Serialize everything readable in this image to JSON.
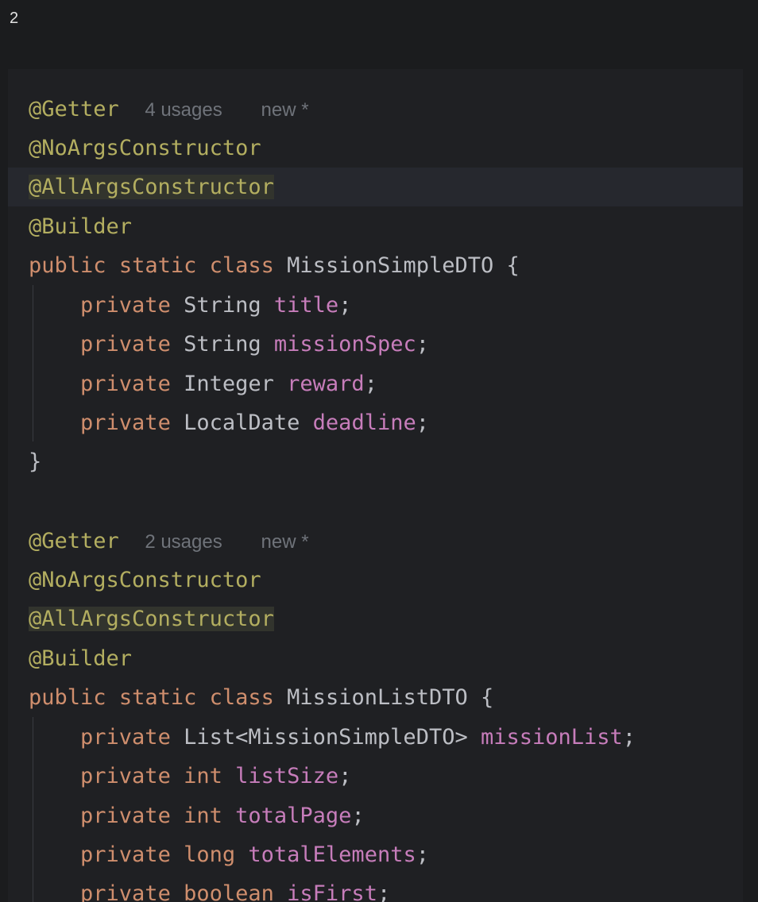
{
  "page_label": "2",
  "code": {
    "block1": {
      "annotation_getter": "@Getter",
      "usages_hint": "4 usages",
      "new_hint": "new *",
      "annotation_noargs": "@NoArgsConstructor",
      "annotation_allargs": "@AllArgsConstructor",
      "annotation_builder": "@Builder",
      "class_decl": {
        "kw_public": "public",
        "kw_static": "static",
        "kw_class": "class",
        "class_name": "MissionSimpleDTO",
        "brace_open": "{"
      },
      "fields": [
        {
          "modifier": "private",
          "type": "String",
          "name": "title",
          "semi": ";"
        },
        {
          "modifier": "private",
          "type": "String",
          "name": "missionSpec",
          "semi": ";"
        },
        {
          "modifier": "private",
          "type": "Integer",
          "name": "reward",
          "semi": ";"
        },
        {
          "modifier": "private",
          "type": "LocalDate",
          "name": "deadline",
          "semi": ";"
        }
      ],
      "brace_close": "}"
    },
    "block2": {
      "annotation_getter": "@Getter",
      "usages_hint": "2 usages",
      "new_hint": "new *",
      "annotation_noargs": "@NoArgsConstructor",
      "annotation_allargs": "@AllArgsConstructor",
      "annotation_builder": "@Builder",
      "class_decl": {
        "kw_public": "public",
        "kw_static": "static",
        "kw_class": "class",
        "class_name": "MissionListDTO",
        "brace_open": "{"
      },
      "fields": [
        {
          "modifier": "private",
          "type": "List<MissionSimpleDTO>",
          "name": "missionList",
          "semi": ";"
        },
        {
          "modifier": "private",
          "type": "int",
          "name": "listSize",
          "semi": ";"
        },
        {
          "modifier": "private",
          "type": "int",
          "name": "totalPage",
          "semi": ";"
        },
        {
          "modifier": "private",
          "type": "long",
          "name": "totalElements",
          "semi": ";"
        },
        {
          "modifier": "private",
          "type": "boolean",
          "name": "isFirst",
          "semi": ";"
        }
      ]
    }
  },
  "colors": {
    "background": "#1b1c1e",
    "editor_background": "#1f2023",
    "annotation": "#b3ae60",
    "keyword": "#cf8e6d",
    "field": "#c77dbb",
    "text": "#bcbec4",
    "hint": "#6f737a"
  }
}
